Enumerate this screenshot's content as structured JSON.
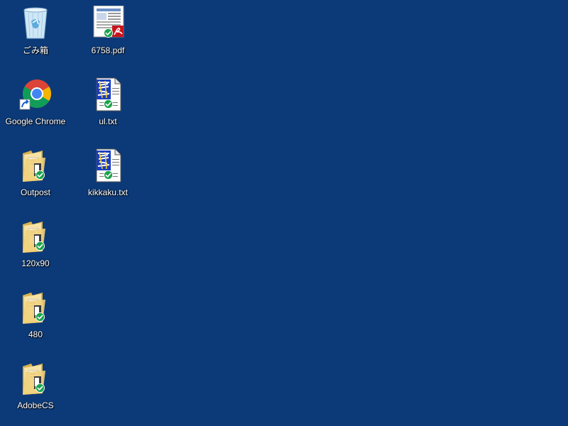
{
  "desktop": {
    "background_color": "#0c3a78",
    "icons": [
      {
        "label": "ごみ箱",
        "icon": "recycle-bin-icon"
      },
      {
        "label": "Google Chrome",
        "icon": "chrome-shortcut-icon"
      },
      {
        "label": "Outpost",
        "icon": "folder-icon"
      },
      {
        "label": "120x90",
        "icon": "folder-icon"
      },
      {
        "label": "480",
        "icon": "folder-icon"
      },
      {
        "label": "AdobeCS",
        "icon": "folder-icon"
      },
      {
        "label": "6758.pdf",
        "icon": "pdf-file-icon"
      },
      {
        "label": "ul.txt",
        "icon": "text-file-icon"
      },
      {
        "label": "kikkaku.txt",
        "icon": "text-file-icon"
      }
    ]
  },
  "colors": {
    "sync_badge_green": "#1aa34a",
    "folder_yellow": "#f2d27a",
    "pdf_red": "#c8141c"
  }
}
